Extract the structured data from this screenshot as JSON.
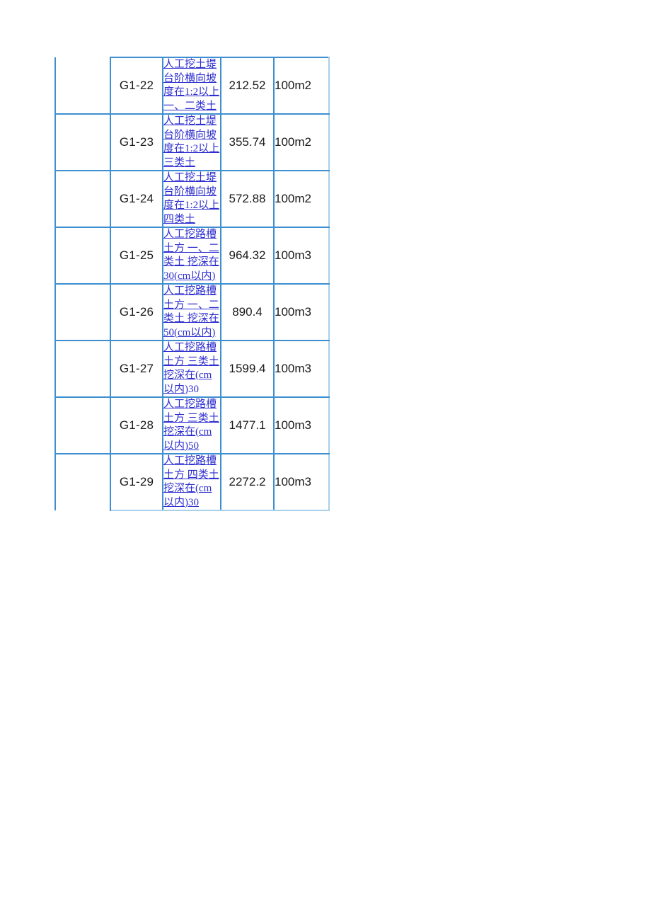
{
  "document": {
    "page_background": "#ffffff",
    "accent_color": "#3d8fd1",
    "link_color": "#2f2fd0",
    "text_color": "#1a1a1a"
  },
  "table": {
    "name": "construction-quota-price-table",
    "columns": [
      {
        "key": "filler",
        "label": ""
      },
      {
        "key": "code",
        "label": ""
      },
      {
        "key": "description",
        "label": ""
      },
      {
        "key": "quantity",
        "label": ""
      },
      {
        "key": "unit",
        "label": ""
      }
    ],
    "rows": [
      {
        "code": "G1-22",
        "description_parts": [
          {
            "text": "人工挖土堤台阶横向坡度在1:2以上 一、二类土",
            "underlined": true
          }
        ],
        "description_plain": "人工挖土堤台阶横向坡度在1:2以上 一、二类土",
        "quantity": "212.52",
        "unit": "100m2"
      },
      {
        "code": "G1-23",
        "description_parts": [
          {
            "text": "人工挖土堤台阶横向坡度在1:2以上 三类土",
            "underlined": true
          }
        ],
        "description_plain": "人工挖土堤台阶横向坡度在1:2以上 三类土",
        "quantity": "355.74",
        "unit": "100m2"
      },
      {
        "code": "G1-24",
        "description_parts": [
          {
            "text": "人工挖土堤台阶横向坡度在1:2以上 四类土",
            "underlined": true
          }
        ],
        "description_plain": "人工挖土堤台阶横向坡度在1:2以上 四类土",
        "quantity": "572.88",
        "unit": "100m2"
      },
      {
        "code": "G1-25",
        "description_parts": [
          {
            "text": "人工挖路槽土方 一、二类土 挖深在 30(cm以内)",
            "underlined": true
          }
        ],
        "description_plain": "人工挖路槽土方 一、二类土 挖深在 30(cm以内)",
        "quantity": "964.32",
        "unit": "100m3"
      },
      {
        "code": "G1-26",
        "description_parts": [
          {
            "text": "人工挖路槽土方 一、二类土 挖深在50(cm以内)",
            "underlined": true
          }
        ],
        "description_plain": "人工挖路槽土方 一、二类土 挖深在50(cm以内)",
        "quantity": "890.4",
        "unit": "100m3"
      },
      {
        "code": "G1-27",
        "description_parts": [
          {
            "text": "人工挖路槽土方 三类土 挖深在(cm以内)",
            "underlined": true
          },
          {
            "text": "30",
            "underlined": false
          }
        ],
        "description_plain": "人工挖路槽土方 三类土 挖深在(cm以内)30",
        "quantity": "1599.4",
        "unit": "100m3"
      },
      {
        "code": "G1-28",
        "description_parts": [
          {
            "text": "人工挖路槽土方 三类土 挖深在(cm以内)",
            "underlined": true
          },
          {
            "text": "50",
            "underlined": true
          }
        ],
        "description_plain": "人工挖路槽土方 三类土 挖深在(cm以内)50",
        "quantity": "1477.1",
        "unit": "100m3"
      },
      {
        "code": "G1-29",
        "description_parts": [
          {
            "text": "人工挖路槽土方 四类土 挖深在(cm以内)",
            "underlined": true
          },
          {
            "text": "30",
            "underlined": true
          }
        ],
        "description_plain": "人工挖路槽土方 四类土 挖深在(cm以内)30",
        "quantity": "2272.2",
        "unit": "100m3"
      }
    ]
  }
}
